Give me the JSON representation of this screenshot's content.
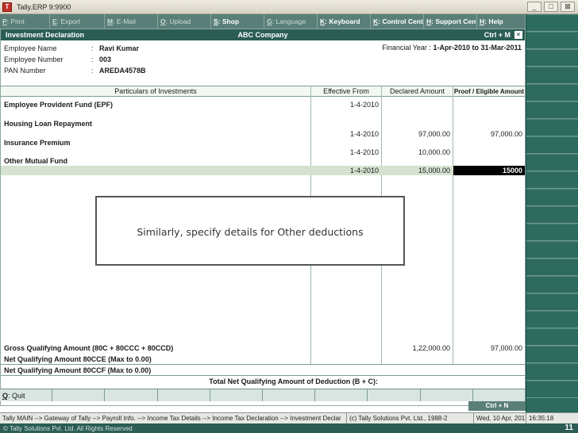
{
  "window": {
    "title": "Tally.ERP 9:9900",
    "app_icon": "tally-icon",
    "controls": [
      "_",
      "□",
      "⊠"
    ]
  },
  "toolbar": [
    {
      "key": "P",
      "label": ": Print"
    },
    {
      "key": "E",
      "label": ": Export"
    },
    {
      "key": "M",
      "label": ": E-Mail"
    },
    {
      "key": "O",
      "label": ": Upload"
    },
    {
      "key": "S",
      "label": ": Shop"
    },
    {
      "key": "G",
      "label": ": Language"
    },
    {
      "key": "K",
      "label": ": Keyboard"
    },
    {
      "key": "K",
      "label": ": Control Centre"
    },
    {
      "key": "H",
      "label": ": Support Centre"
    },
    {
      "key": "H",
      "label": ": Help"
    }
  ],
  "form": {
    "title": "Investment Declaration",
    "company": "ABC Company",
    "shortcut": "Ctrl + M",
    "close": "×"
  },
  "employee": {
    "name_label": "Employee Name",
    "name": "Ravi Kumar",
    "number_label": "Employee Number",
    "number": "003",
    "pan_label": "PAN Number",
    "pan": "AREDA4578B",
    "colon": ":",
    "fy_label": "Financial Year :",
    "fy_value": "1-Apr-2010 to 31-Mar-2011"
  },
  "table": {
    "headers": {
      "particulars": "Particulars of Investments",
      "effective": "Effective From",
      "declared": "Declared Amount",
      "proof": "Proof / Eligible Amount"
    },
    "rows": [
      {
        "label": "Employee Provident Fund (EPF)",
        "effective": "1-4-2010",
        "declared": "",
        "proof": ""
      },
      {
        "label": "Housing Loan Repayment",
        "effective": "1-4-2010",
        "declared": "97,000.00",
        "proof": "97,000.00"
      },
      {
        "label": "Insurance Premium",
        "effective": "1-4-2010",
        "declared": "10,000.00",
        "proof": ""
      },
      {
        "label": "Other Mutual Fund",
        "effective": "1-4-2010",
        "declared": "15,000.00",
        "proof": "15000"
      }
    ]
  },
  "callout": {
    "text": "Similarly, specify details for Other deductions"
  },
  "totals": {
    "gross_label": "Gross Qualifying Amount (80C + 80CCC + 80CCD)",
    "gross_declared": "1,22,000.00",
    "gross_proof": "97,000.00",
    "cce_label": "Net Qualifying Amount 80CCE (Max to 0.00)",
    "ccf_label": "Net Qualifying Amount 80CCF (Max to 0.00)",
    "net_label": "Total Net Qualifying Amount of Deduction (B + C):"
  },
  "bottom_bar": {
    "quit_key": "Q",
    "quit_label": ": Quit",
    "ctrl_n": "Ctrl + N"
  },
  "status": {
    "path": "Tally MAIN --> Gateway of Tally --> Payroll Info. --> Income Tax Details --> Income Tax Declaration --> Investment Declar",
    "copyright": "(c) Tally Solutions Pvt. Ltd., 1988-2",
    "date": "Wed, 10 Apr, 201",
    "time": "16:35:18"
  },
  "footer": {
    "text": "© Tally Solutions Pvt. Ltd. All Rights Reserved",
    "page": "11"
  },
  "colors": {
    "header_green": "#2b5d55",
    "toolbar_green": "#5a7f78",
    "panel_green": "#2e6b5f",
    "highlight": "#d5e2d0"
  }
}
